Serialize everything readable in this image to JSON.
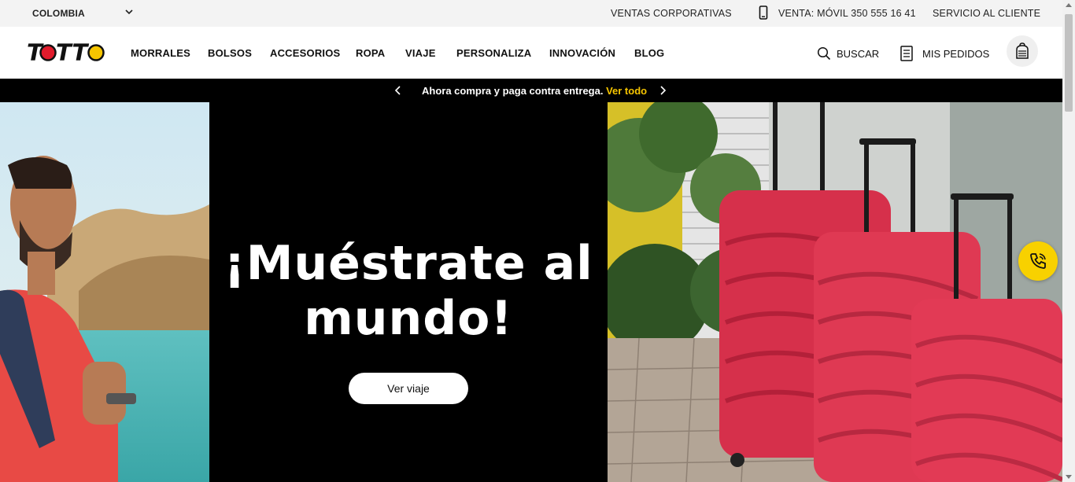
{
  "topbar": {
    "country": "COLOMBIA",
    "corporate": "VENTAS CORPORATIVAS",
    "sales_phone": "VENTA: MÓVIL 350 555 16 41",
    "customer_service": "SERVICIO AL CLIENTE"
  },
  "header": {
    "logo_text": "TOTTO",
    "nav": [
      "MORRALES",
      "BOLSOS",
      "ACCESORIOS",
      "ROPA",
      "VIAJE",
      "PERSONALIZA",
      "INNOVACIÓN",
      "BLOG"
    ],
    "search_label": "BUSCAR",
    "orders_label": "MIS PEDIDOS"
  },
  "promo": {
    "text": "Ahora compra y paga contra entrega.",
    "link": "Ver todo"
  },
  "hero": {
    "title_line1": "¡Muéstrate al",
    "title_line2": "mundo!",
    "button": "Ver viaje"
  },
  "colors": {
    "accent_yellow": "#f6c500",
    "brand_red": "#e01b2c",
    "suitcase_red": "#d6304b"
  },
  "icons": {
    "country_dropdown": "chevron-down-icon",
    "phone": "mobile-phone-icon",
    "search": "search-icon",
    "orders": "document-list-icon",
    "cart": "backpack-icon",
    "promo_prev": "chevron-left-icon",
    "promo_next": "chevron-right-icon",
    "call": "phone-call-icon"
  }
}
